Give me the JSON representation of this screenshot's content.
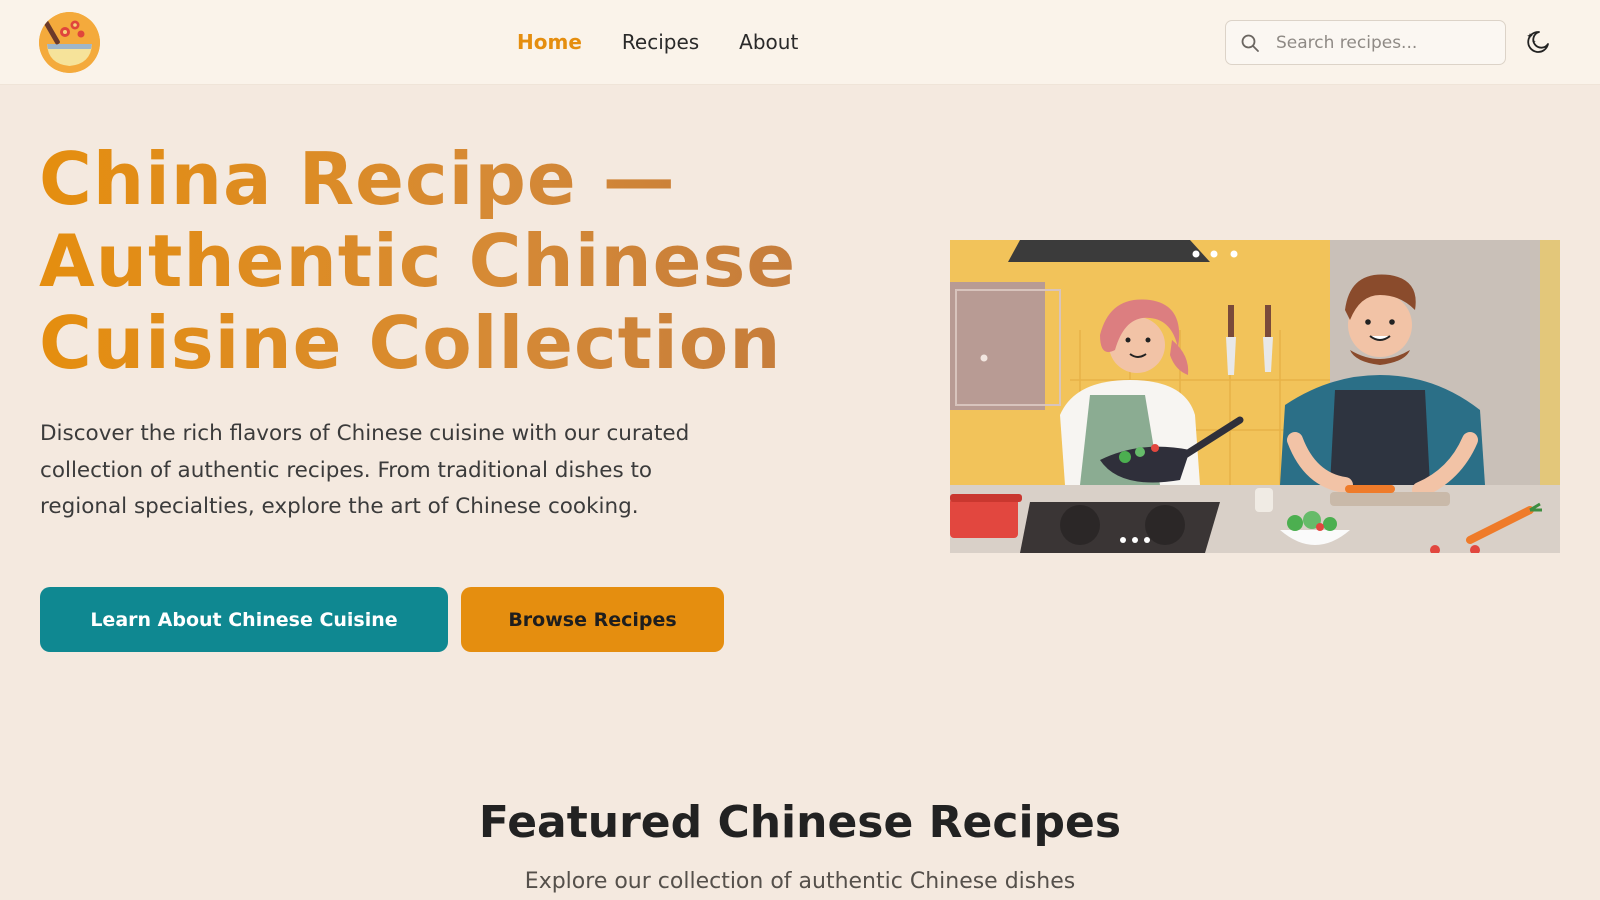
{
  "header": {
    "logo_icon": "cooking-bowl-logo",
    "nav": [
      {
        "label": "Home",
        "active": true
      },
      {
        "label": "Recipes",
        "active": false
      },
      {
        "label": "About",
        "active": false
      }
    ],
    "search": {
      "placeholder": "Search recipes...",
      "value": "",
      "icon": "search-icon"
    },
    "theme_toggle_icon": "moon-icon"
  },
  "hero": {
    "title": "China Recipe — Authentic Chinese Cuisine Collection",
    "description": "Discover the rich flavors of Chinese cuisine with our curated collection of authentic recipes. From traditional dishes to regional specialties, explore the art of Chinese cooking.",
    "primary_button": "Learn About Chinese Cuisine",
    "secondary_button": "Browse Recipes",
    "image": "illustration of a woman and man cooking in a kitchen"
  },
  "featured": {
    "title": "Featured Chinese Recipes",
    "subtitle": "Explore our collection of authentic Chinese dishes"
  },
  "colors": {
    "accent_orange": "#e58e0f",
    "teal": "#0f8891",
    "page_bg": "#f4e9df",
    "header_bg": "#faf3ea"
  }
}
